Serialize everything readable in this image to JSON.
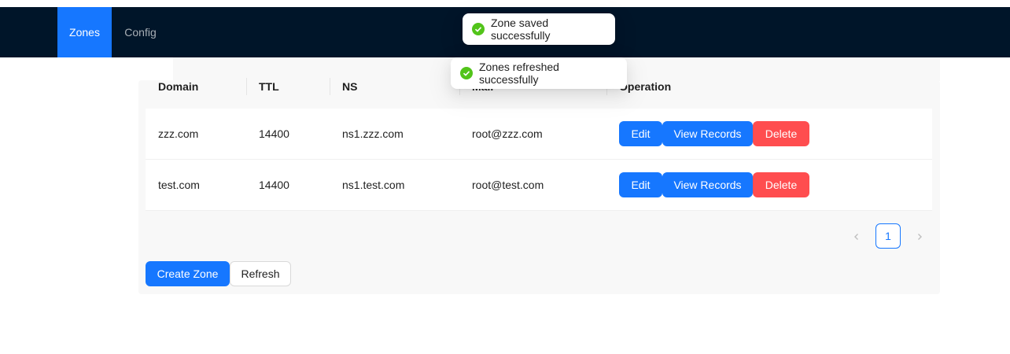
{
  "nav": {
    "items": [
      {
        "label": "Zones",
        "active": true
      },
      {
        "label": "Config",
        "active": false
      }
    ]
  },
  "toasts": [
    {
      "text": "Zone saved successfully",
      "icon": "check-circle-icon"
    },
    {
      "text": "Zones refreshed successfully",
      "icon": "check-circle-icon"
    }
  ],
  "table": {
    "columns": [
      "Domain",
      "TTL",
      "NS",
      "Mail",
      "Operation"
    ],
    "rows": [
      {
        "domain": "zzz.com",
        "ttl": "14400",
        "ns": "ns1.zzz.com",
        "mail": "root@zzz.com"
      },
      {
        "domain": "test.com",
        "ttl": "14400",
        "ns": "ns1.test.com",
        "mail": "root@test.com"
      }
    ],
    "actions": {
      "edit": "Edit",
      "view": "View Records",
      "delete": "Delete"
    }
  },
  "pagination": {
    "current_page": "1"
  },
  "footer": {
    "create_label": "Create Zone",
    "refresh_label": "Refresh"
  },
  "colors": {
    "nav_bg": "#001529",
    "primary": "#1677ff",
    "danger": "#ff4d4f",
    "success": "#52c41a"
  }
}
